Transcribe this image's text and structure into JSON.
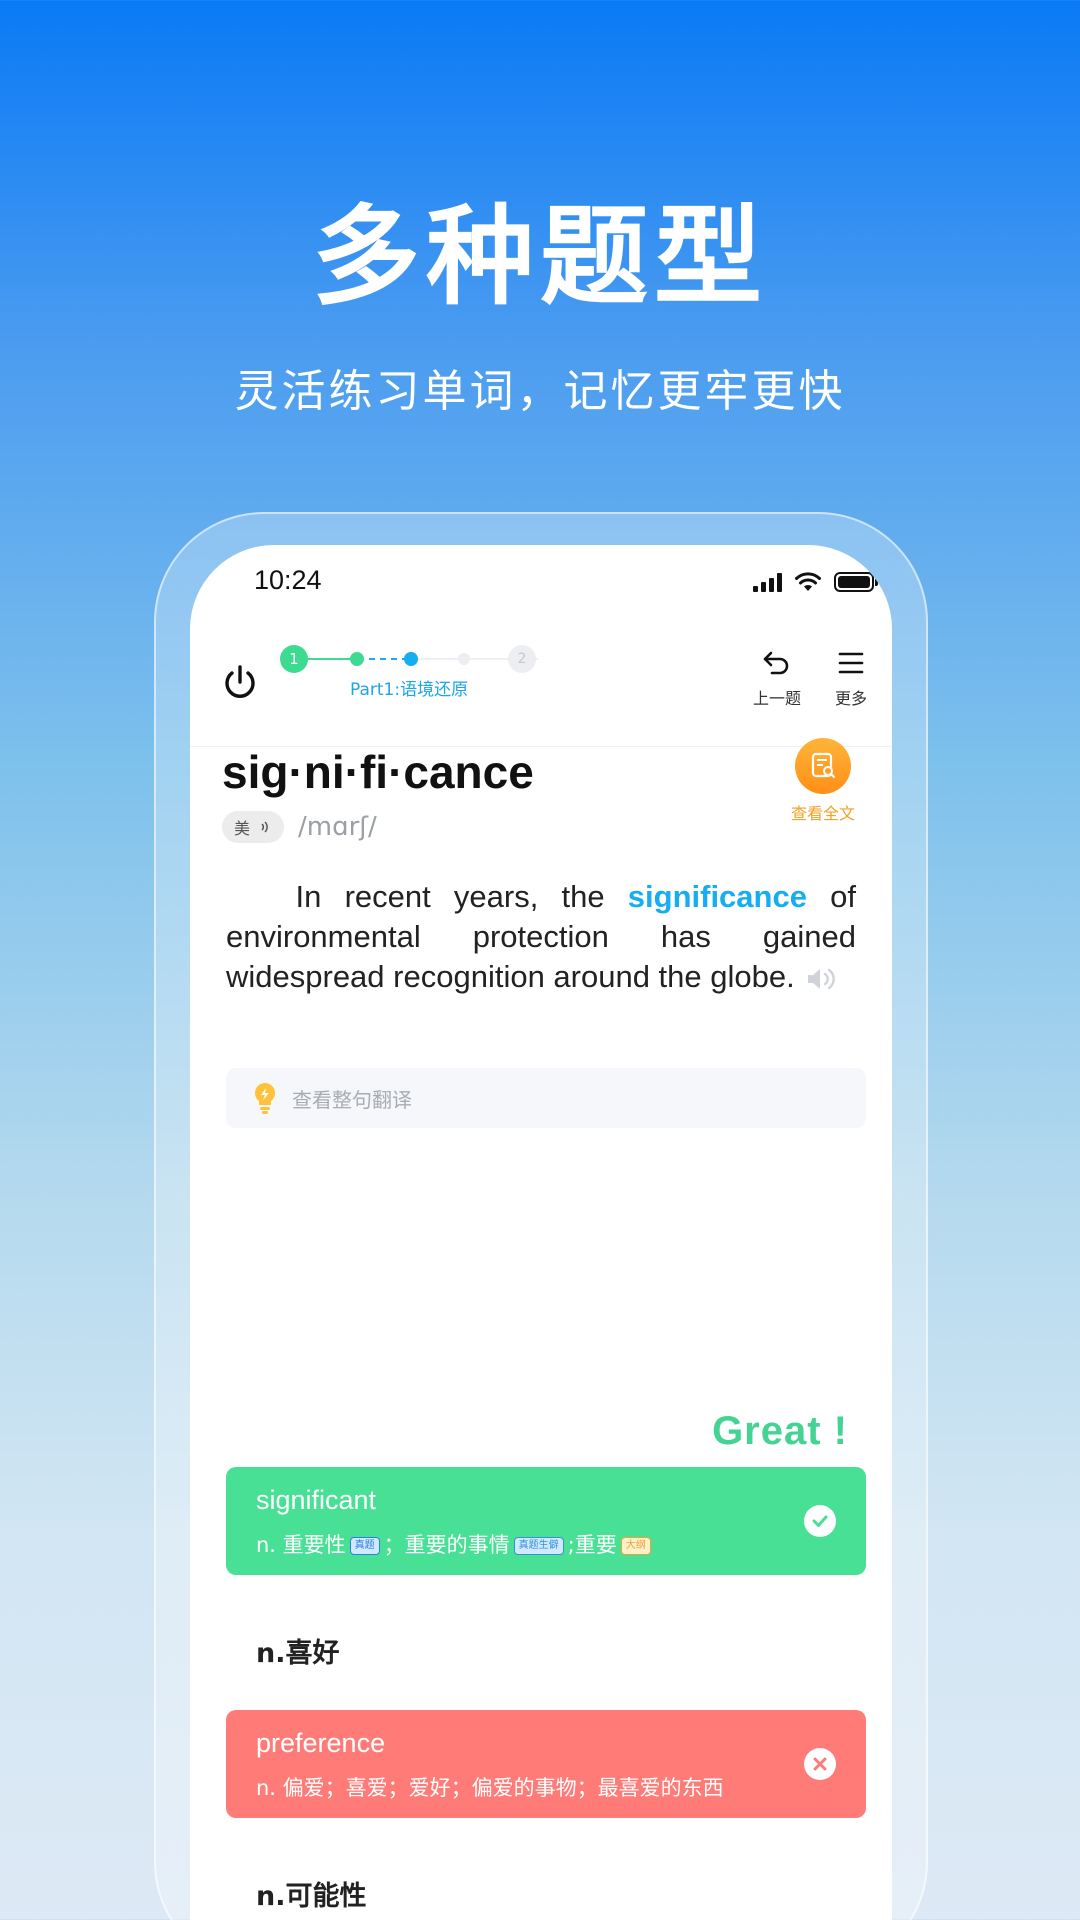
{
  "hero": {
    "title": "多种题型",
    "subtitle": "灵活练习单词，记忆更牢更快"
  },
  "status_bar": {
    "time": "10:24",
    "icons": [
      "signal-icon",
      "wifi-icon",
      "battery-icon"
    ]
  },
  "progress": {
    "step1": "1",
    "step2": "2",
    "part_label": "Part1:语境还原",
    "active_color": "#3ddb8f",
    "current_color": "#16aef0"
  },
  "nav": {
    "prev_label": "上一题",
    "more_label": "更多"
  },
  "word": {
    "syllables": "sig·ni·fi·cance",
    "accent": "美",
    "phonetic": "/mɑrʃ/",
    "fulltext_label": "查看全文"
  },
  "sentence": {
    "before": "In recent years, the ",
    "highlight": "significance",
    "after": " of environmental protection has gained widespread recognition around the globe."
  },
  "translation": {
    "label": "查看整句翻译"
  },
  "feedback": {
    "text": "Great !"
  },
  "options": [
    {
      "word": "significant",
      "def_part1": "n. 重要性",
      "tag1": "真题",
      "def_part2": "；重要的事情",
      "tag2": "真题生僻",
      "def_part3": ";重要",
      "tag3": "大纲",
      "state": "correct"
    },
    {
      "text": "n.喜好"
    },
    {
      "word": "preference",
      "def": "n. 偏爱；喜爱；爱好；偏爱的事物；最喜爱的东西",
      "state": "wrong"
    },
    {
      "text": "n.可能性"
    }
  ],
  "colors": {
    "correct": "#47e095",
    "wrong": "#ff7b77",
    "accent_blue": "#16aef0",
    "orange": "#f5a023"
  }
}
